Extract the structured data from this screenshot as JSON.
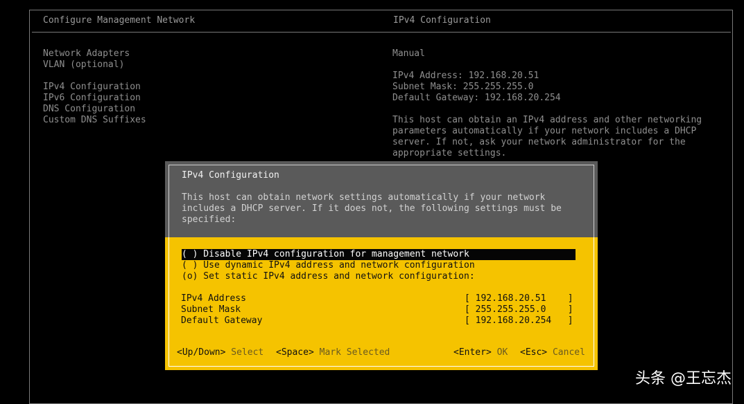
{
  "header": {
    "left_title": "Configure Management Network",
    "right_title": "IPv4 Configuration"
  },
  "menu": {
    "items": [
      {
        "label": "Network Adapters"
      },
      {
        "label": "VLAN (optional)"
      },
      {
        "label": "IPv4 Configuration"
      },
      {
        "label": "IPv6 Configuration"
      },
      {
        "label": "DNS Configuration"
      },
      {
        "label": "Custom DNS Suffixes"
      }
    ]
  },
  "detail": {
    "mode": "Manual",
    "address": "IPv4 Address: 192.168.20.51",
    "mask": "Subnet Mask: 255.255.255.0",
    "gateway": "Default Gateway: 192.168.20.254",
    "desc": [
      "This host can obtain an IPv4 address and other networking",
      "parameters automatically if your network includes a DHCP",
      "server. If not, ask your network administrator for the",
      "appropriate settings."
    ]
  },
  "dialog": {
    "title": "IPv4 Configuration",
    "desc": [
      "This host can obtain network settings automatically if your network",
      "includes a DHCP server. If it does not, the following settings must be",
      "specified:"
    ],
    "options": [
      {
        "label": "( ) Disable IPv4 configuration for management network"
      },
      {
        "label": "( ) Use dynamic IPv4 address and network configuration"
      },
      {
        "label": "(o) Set static IPv4 address and network configuration:"
      }
    ],
    "fields": [
      {
        "label": "IPv4 Address",
        "value": "[ 192.168.20.51    ]"
      },
      {
        "label": "Subnet Mask",
        "value": "[ 255.255.255.0    ]"
      },
      {
        "label": "Default Gateway",
        "value": "[ 192.168.20.254   ]"
      }
    ],
    "keys": {
      "updown_key": "<Up/Down>",
      "updown_action": "Select",
      "space_key": "<Space>",
      "space_action": "Mark Selected",
      "enter_key": "<Enter>",
      "enter_action": "OK",
      "esc_key": "<Esc>",
      "esc_action": "Cancel"
    }
  },
  "watermark": "头条 @王忘杰"
}
